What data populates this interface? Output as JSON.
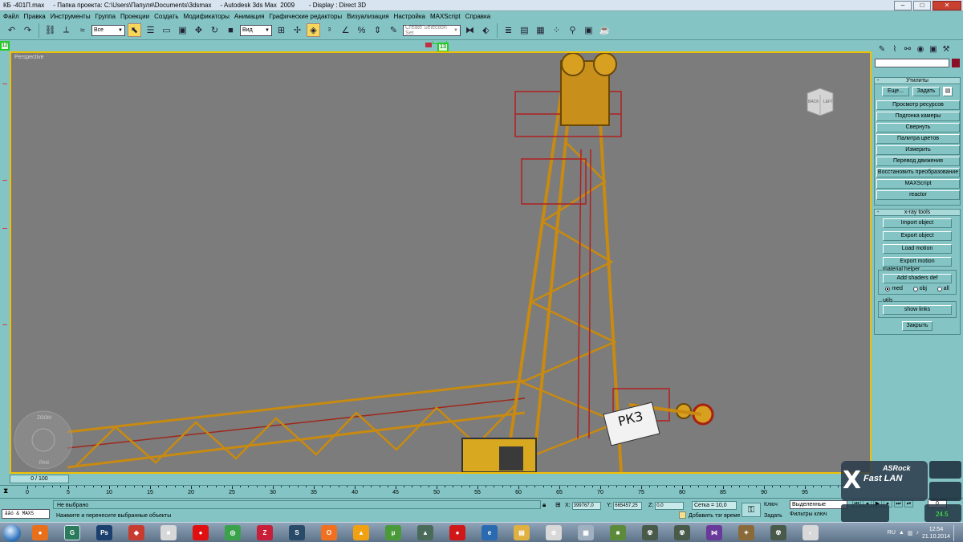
{
  "window": {
    "title": "КБ -401П.max     - Папка проекта: C:\\Users\\Папуля\\Documents\\3dsmax     - Autodesk 3ds Max  2009        - Display : Direct 3D",
    "min": "‒",
    "max": "□",
    "close": "✕"
  },
  "menu": [
    "Файл",
    "Правка",
    "Инструменты",
    "Группа",
    "Проекции",
    "Создать",
    "Модификаторы",
    "Анимация",
    "Графические редакторы",
    "Визуализация",
    "Настройка",
    "MAXScript",
    "Справка"
  ],
  "toolbar": {
    "selection_filter": "Все",
    "ref_coord": "Вид",
    "named_selection_placeholder": "Create Selection Set"
  },
  "viewport": {
    "label": "Perspective",
    "viewcube_back": "BACK",
    "viewcube_left": "LEFT",
    "wheel_zoom": "ZOOM",
    "wheel_pan": "PAN",
    "sign_text": "РКЗ",
    "overlay_logo_top": "ASRock",
    "overlay_logo_bottom": "Fast LAN"
  },
  "command_panel": {
    "utilities_header": "Утилиты",
    "more_button": "Еще...",
    "sets_button": "Задать",
    "utility_buttons": [
      "Просмотр ресурсов",
      "Подгонка камеры",
      "Свернуть",
      "Палитра цветов",
      "Измерить",
      "Перевод движения",
      "Восстановить преобразование",
      "MAXScript",
      "reactor"
    ],
    "xray_header": "x-ray tools",
    "xray_buttons": [
      "Import object",
      "Export object",
      "Load motion",
      "Export motion"
    ],
    "material_group": "material helper",
    "add_shaders": "Add shaders def",
    "radios": [
      {
        "label": "med",
        "on": true
      },
      {
        "label": "obj",
        "on": false
      },
      {
        "label": "all",
        "on": false
      }
    ],
    "utils_group": "utils",
    "show_links": "show links",
    "close_button": "Закрыть"
  },
  "timeline": {
    "slider": "0 / 100",
    "ticks": [
      "0",
      "5",
      "10",
      "15",
      "20",
      "25",
      "30",
      "35",
      "40",
      "45",
      "50",
      "55",
      "60",
      "65",
      "70",
      "75",
      "80",
      "85",
      "90",
      "95"
    ]
  },
  "status": {
    "maxscript": "ååó & MAXS",
    "selection_msg": "Не выбрано",
    "prompt": "Нажмите и перенесите выбранные объекты",
    "x_label": "X:",
    "x_value": "399767,0",
    "y_label": "Y:",
    "y_value": "665457,25",
    "z_label": "Z:",
    "z_value": "0,0",
    "grid": "Сетка = 10,0",
    "add_tag": "Добавить тэг време",
    "key_label": "Ключ",
    "set_label": "Задать",
    "key_filter": "Выделенные",
    "filters": "Фильтры ключ",
    "frame": "0",
    "fps_overlay": "24.5"
  },
  "taskbar": {
    "apps": [
      {
        "name": "firefox",
        "color": "#e8701c",
        "glyph": "●"
      },
      {
        "name": "3dsmax",
        "color": "#2a7a5c",
        "glyph": "G"
      },
      {
        "name": "photoshop",
        "color": "#1b3f6e",
        "glyph": "Ps"
      },
      {
        "name": "sketchup",
        "color": "#c83c30",
        "glyph": "◆"
      },
      {
        "name": "box",
        "color": "#d8d8d8",
        "glyph": "■"
      },
      {
        "name": "record",
        "color": "#e01010",
        "glyph": "●"
      },
      {
        "name": "chrome",
        "color": "#3aa24a",
        "glyph": "◎"
      },
      {
        "name": "camtasia",
        "color": "#c81e3a",
        "glyph": "Z"
      },
      {
        "name": "steam",
        "color": "#2a4a6a",
        "glyph": "S"
      },
      {
        "name": "origin",
        "color": "#f07020",
        "glyph": "O"
      },
      {
        "name": "aimp",
        "color": "#f0a010",
        "glyph": "▲"
      },
      {
        "name": "utorrent",
        "color": "#4a9a3a",
        "glyph": "µ"
      },
      {
        "name": "game1",
        "color": "#4a6a5a",
        "glyph": "▲"
      },
      {
        "name": "rec2",
        "color": "#d01818",
        "glyph": "●"
      },
      {
        "name": "ie",
        "color": "#2a6ab0",
        "glyph": "e"
      },
      {
        "name": "explorer",
        "color": "#e0b040",
        "glyph": "▤"
      },
      {
        "name": "gamepad",
        "color": "#d8d8d8",
        "glyph": "⊕"
      },
      {
        "name": "calc",
        "color": "#a0b0c0",
        "glyph": "▦"
      },
      {
        "name": "minecraft",
        "color": "#5a8a3a",
        "glyph": "■"
      },
      {
        "name": "stalker1",
        "color": "#4a5a4a",
        "glyph": "☢"
      },
      {
        "name": "stalker2",
        "color": "#4a5a4a",
        "glyph": "☢"
      },
      {
        "name": "vs",
        "color": "#6a3a9a",
        "glyph": "⋈"
      },
      {
        "name": "game2",
        "color": "#8a6a3a",
        "glyph": "✦"
      },
      {
        "name": "stalker3",
        "color": "#4a5a4a",
        "glyph": "☢"
      },
      {
        "name": "paint",
        "color": "#d8d8d8",
        "glyph": "◐"
      }
    ],
    "lang": "RU",
    "time": "12:54",
    "date": "21.10.2014"
  }
}
